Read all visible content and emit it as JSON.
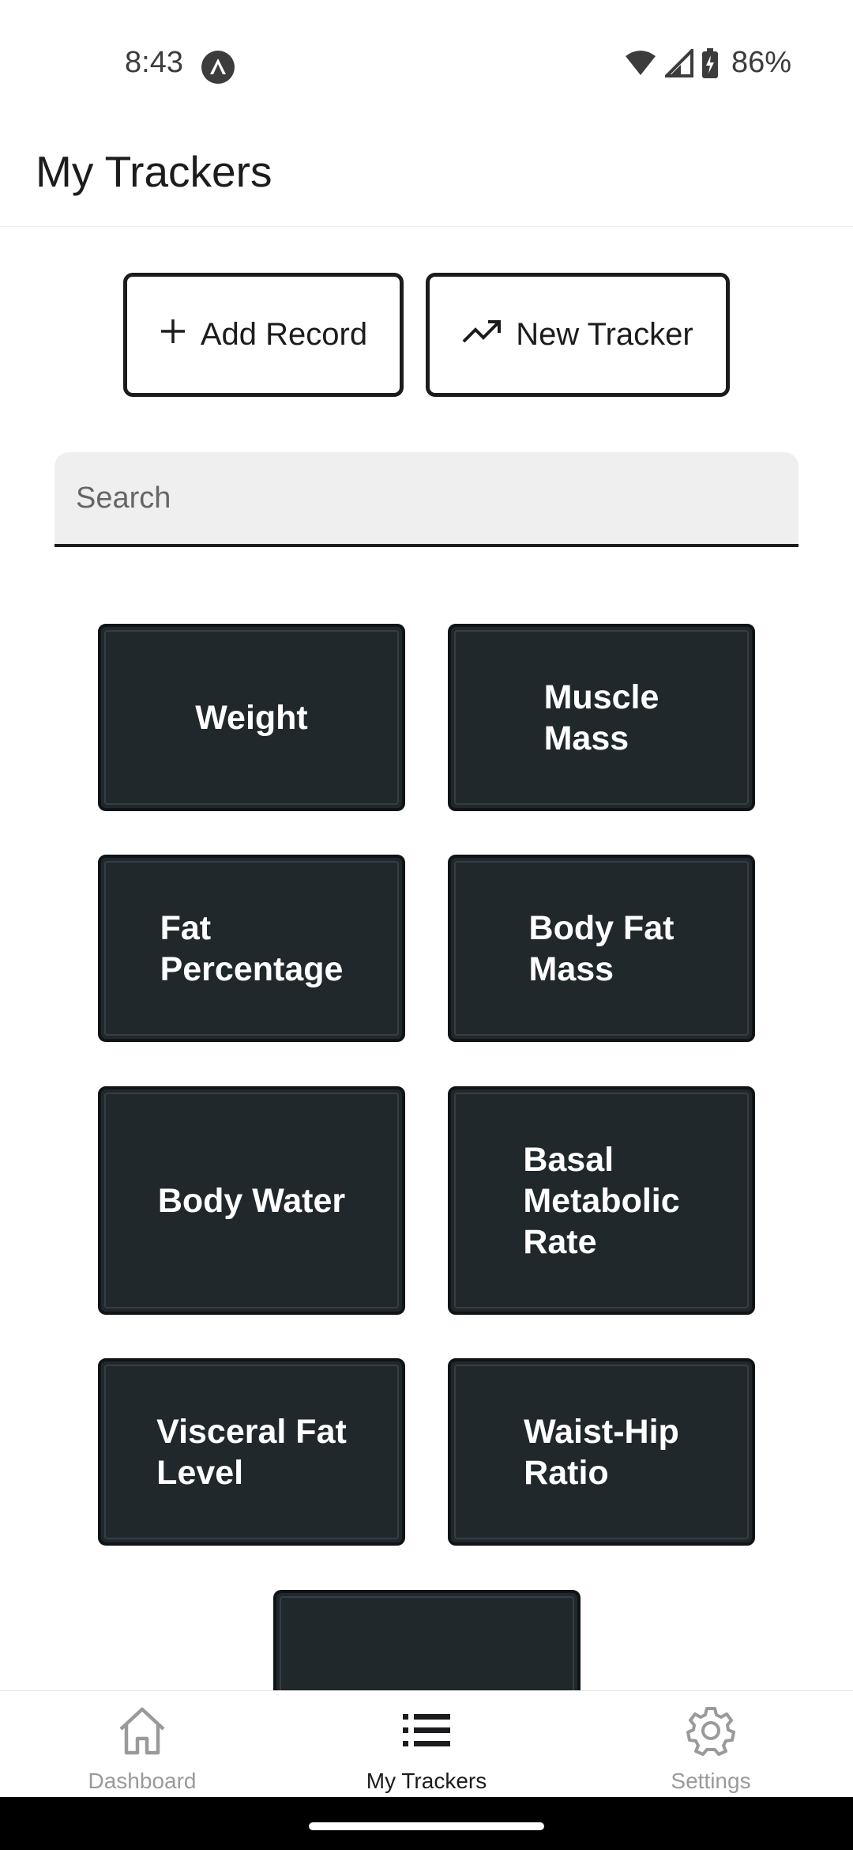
{
  "status_bar": {
    "time": "8:43",
    "battery": "86%"
  },
  "header": {
    "title": "My Trackers"
  },
  "actions": {
    "add_record": "Add Record",
    "new_tracker": "New Tracker"
  },
  "search": {
    "placeholder": "Search",
    "value": ""
  },
  "trackers": [
    {
      "label": "Weight"
    },
    {
      "label": "Muscle\nMass"
    },
    {
      "label": "Fat\nPercentage"
    },
    {
      "label": "Body Fat\nMass"
    },
    {
      "label": "Body Water"
    },
    {
      "label": "Basal\nMetabolic\nRate"
    },
    {
      "label": "Visceral Fat\nLevel"
    },
    {
      "label": "Waist-Hip\nRatio"
    },
    {
      "label": ""
    }
  ],
  "nav": {
    "items": [
      {
        "label": "Dashboard",
        "icon": "home-icon",
        "active": false
      },
      {
        "label": "My Trackers",
        "icon": "list-icon",
        "active": true
      },
      {
        "label": "Settings",
        "icon": "gear-icon",
        "active": false
      }
    ]
  },
  "colors": {
    "tile_background": "#20282c",
    "text_primary": "#1c1c1e",
    "nav_inactive": "#9a9a9a"
  }
}
